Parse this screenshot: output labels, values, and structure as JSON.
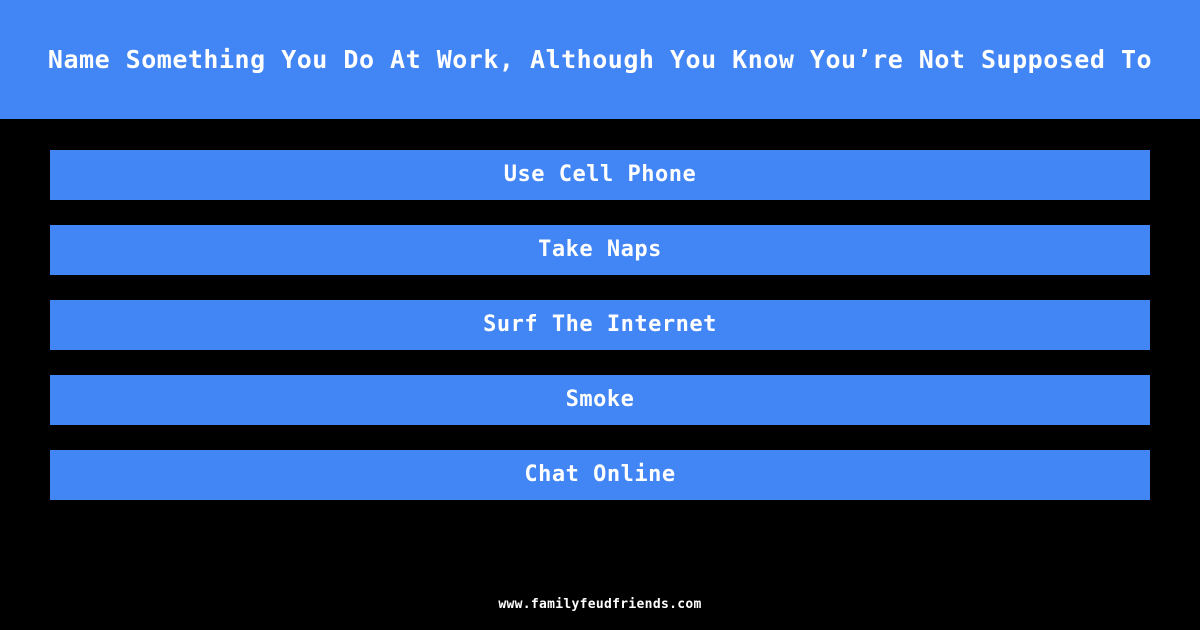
{
  "theme": {
    "background_color": "#000000",
    "accent_color": "#4285f4",
    "text_color": "#ffffff"
  },
  "header": {
    "question": "Name Something You Do At Work, Although You Know You’re Not Supposed To"
  },
  "answers": {
    "count": 5,
    "items": [
      {
        "rank": 1,
        "label": "Use Cell Phone"
      },
      {
        "rank": 2,
        "label": "Take Naps"
      },
      {
        "rank": 3,
        "label": "Surf The Internet"
      },
      {
        "rank": 4,
        "label": "Smoke"
      },
      {
        "rank": 5,
        "label": "Chat Online"
      }
    ]
  },
  "footer": {
    "url": "www.familyfeudfriends.com"
  }
}
